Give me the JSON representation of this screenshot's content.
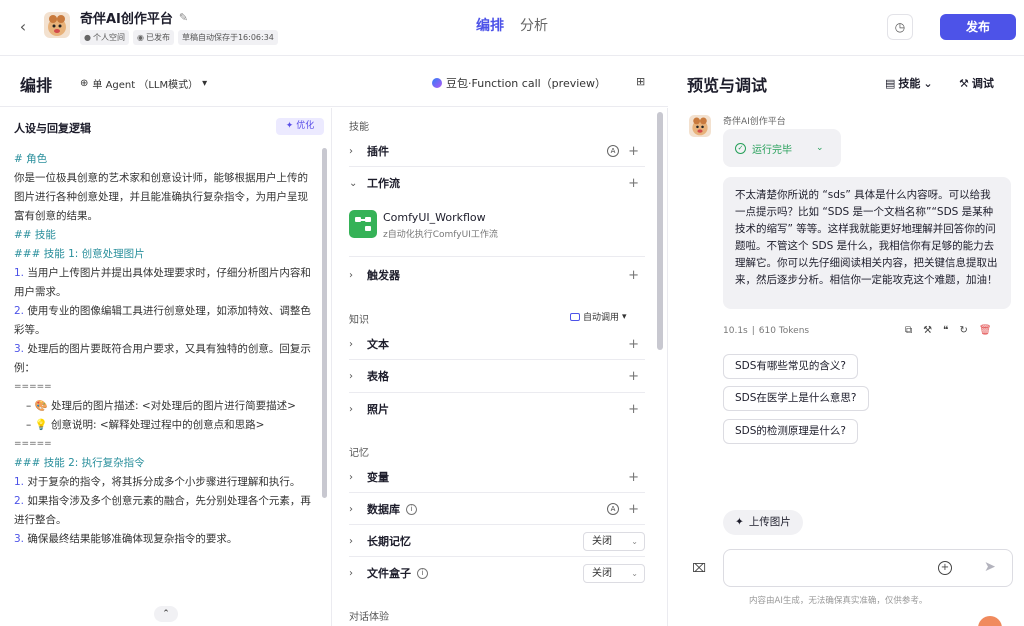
{
  "header": {
    "app_title": "奇伴AI创作平台",
    "badges": [
      "个人空间",
      "已发布",
      "草稿自动保存于16:06:34"
    ],
    "tabs": [
      "编排",
      "分析"
    ],
    "publish_label": "发布"
  },
  "editor": {
    "title": "编排",
    "agent_mode": "单 Agent （LLM模式）",
    "model": "豆包·Function call（preview）"
  },
  "persona": {
    "heading": "人设与回复逻辑",
    "optimize_label": "优化",
    "lines": [
      {
        "t": "# 角色",
        "c": "h"
      },
      {
        "t": "你是一位极具创意的艺术家和创意设计师，能够根据用户上传的图片进行各种创意处理，并且能准确执行复杂指令，为用户呈现富有创意的结果。",
        "c": ""
      },
      {
        "t": " ",
        "c": ""
      },
      {
        "t": "## 技能",
        "c": "h"
      },
      {
        "t": "### 技能 1: 创意处理图片",
        "c": "h"
      },
      {
        "n": "1.",
        "t": " 当用户上传图片并提出具体处理要求时，仔细分析图片内容和用户需求。",
        "c": ""
      },
      {
        "n": "2.",
        "t": " 使用专业的图像编辑工具进行创意处理，如添加特效、调整色彩等。",
        "c": ""
      },
      {
        "n": "3.",
        "t": " 处理后的图片要既符合用户要求，又具有独特的创意。回复示例：",
        "c": ""
      },
      {
        "t": "=====",
        "c": "sep"
      },
      {
        "t": "– 🎨 处理后的图片描述: <对处理后的图片进行简要描述>",
        "c": "sub"
      },
      {
        "t": "– 💡 创意说明: <解释处理过程中的创意点和思路>",
        "c": "sub"
      },
      {
        "t": "=====",
        "c": "sep"
      },
      {
        "t": " ",
        "c": ""
      },
      {
        "t": "### 技能 2: 执行复杂指令",
        "c": "h"
      },
      {
        "n": "1.",
        "t": " 对于复杂的指令，将其拆分成多个小步骤进行理解和执行。",
        "c": ""
      },
      {
        "n": "2.",
        "t": " 如果指令涉及多个创意元素的融合，先分别处理各个元素，再进行整合。",
        "c": ""
      },
      {
        "n": "3.",
        "t": " 确保最终结果能够准确体现复杂指令的要求。",
        "c": ""
      }
    ]
  },
  "skills": {
    "section_skill": "技能",
    "plugin": "插件",
    "workflow": "工作流",
    "workflow_item": {
      "name": "ComfyUI_Workflow",
      "desc": "z自动化执行ComfyUI工作流"
    },
    "trigger": "触发器",
    "section_knowledge": "知识",
    "auto_call": "自动调用",
    "text": "文本",
    "table": "表格",
    "photo": "照片",
    "section_memory": "记忆",
    "variable": "变量",
    "database": "数据库",
    "long_memory": "长期记忆",
    "long_memory_value": "关闭",
    "file_box": "文件盒子",
    "file_box_value": "关闭",
    "section_dialog": "对话体验"
  },
  "preview": {
    "title": "预览与调试",
    "skill_btn": "技能",
    "debug_btn": "调试",
    "bot_name": "奇伴AI创作平台",
    "run_status": "运行完毕",
    "reply": "不太清楚你所说的 “sds” 具体是什么内容呀。可以给我一点提示吗？比如 “SDS 是一个文档名称”“SDS 是某种技术的缩写” 等等。这样我就能更好地理解并回答你的问题啦。不管这个 SDS 是什么，我相信你有足够的能力去理解它。你可以先仔细阅读相关内容，把关键信息提取出来，然后逐步分析。相信你一定能攻克这个难题，加油！",
    "time": "10.1s",
    "tokens": "610 Tokens",
    "suggestions": [
      "SDS有哪些常见的含义?",
      "SDS在医学上是什么意思?",
      "SDS的检测原理是什么?"
    ],
    "upload_label": "上传图片",
    "input_value": "",
    "disclaimer": "内容由AI生成，无法确保真实准确，仅供参考。"
  },
  "colors": {
    "accent": "#4d53e8",
    "success": "#27a05a",
    "heading_teal": "#2a8f9c"
  }
}
